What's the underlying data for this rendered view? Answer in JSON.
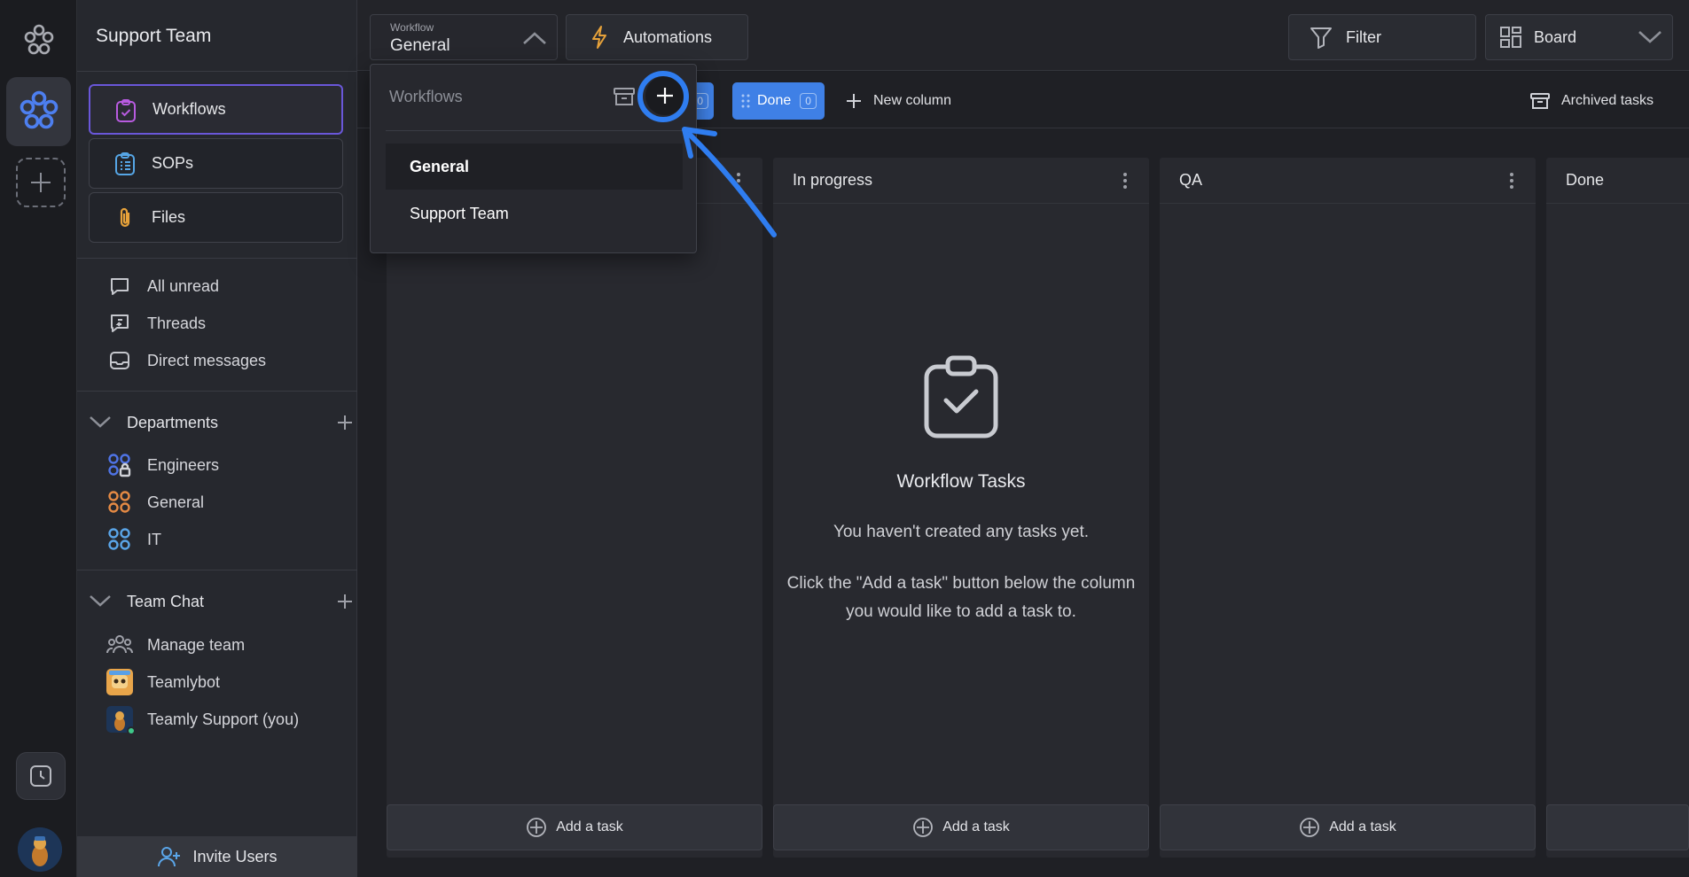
{
  "colors": {
    "accent": "#3f80e6",
    "active_border": "#6a57d9",
    "annotation": "#2f7df0"
  },
  "sidebar": {
    "title": "Support Team",
    "nav": [
      {
        "label": "Workflows",
        "icon": "clipboard-check-icon",
        "active": true
      },
      {
        "label": "SOPs",
        "icon": "list-clipboard-icon"
      },
      {
        "label": "Files",
        "icon": "paperclip-icon"
      }
    ],
    "inbox": [
      {
        "label": "All unread",
        "icon": "chat-bubble-icon"
      },
      {
        "label": "Threads",
        "icon": "threads-icon"
      },
      {
        "label": "Direct messages",
        "icon": "inbox-icon"
      }
    ],
    "departments": {
      "title": "Departments",
      "items": [
        {
          "label": "Engineers",
          "icon": "group-lock-icon"
        },
        {
          "label": "General",
          "icon": "group-icon"
        },
        {
          "label": "IT",
          "icon": "group-icon"
        }
      ]
    },
    "team_chat": {
      "title": "Team Chat",
      "items": [
        {
          "label": "Manage team",
          "icon": "people-icon"
        },
        {
          "label": "Teamlybot",
          "icon": "bot-avatar"
        },
        {
          "label": "Teamly Support (you)",
          "icon": "user-avatar"
        }
      ]
    },
    "invite_label": "Invite Users"
  },
  "topbar": {
    "workflow_caption": "Workflow",
    "workflow_value": "General",
    "automations": "Automations",
    "filter": "Filter",
    "view": "Board"
  },
  "column_toolbar": {
    "hidden_pill_count": "0",
    "done_label": "Done",
    "done_count": "0",
    "new_column": "New column",
    "archived": "Archived tasks"
  },
  "dropdown": {
    "header": "Workflows",
    "items": [
      "General",
      "Support Team"
    ]
  },
  "board": {
    "columns": [
      {
        "title": ""
      },
      {
        "title": "In progress"
      },
      {
        "title": "QA"
      },
      {
        "title": "Done"
      }
    ],
    "add_task": "Add a task",
    "empty": {
      "title": "Workflow Tasks",
      "line1": "You haven't created any tasks yet.",
      "line2": "Click the \"Add a task\" button below the column",
      "line3": "you would like to add a task to."
    }
  }
}
